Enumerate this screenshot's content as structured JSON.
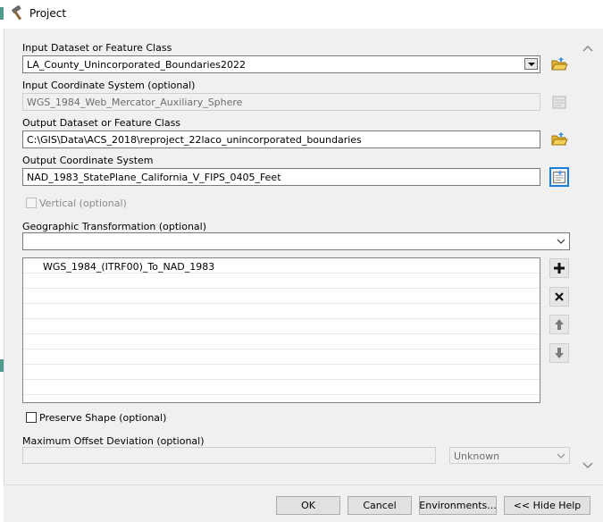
{
  "window": {
    "title": "Project"
  },
  "input_dataset": {
    "label": "Input Dataset or Feature Class",
    "value": "LA_County_Unincorporated_Boundaries2022"
  },
  "input_cs": {
    "label": "Input Coordinate System (optional)",
    "value": "WGS_1984_Web_Mercator_Auxiliary_Sphere"
  },
  "output_dataset": {
    "label": "Output Dataset or Feature Class",
    "value": "C:\\GIS\\Data\\ACS_2018\\reproject_22laco_unincorporated_boundaries"
  },
  "output_cs": {
    "label": "Output Coordinate System",
    "value": "NAD_1983_StatePlane_California_V_FIPS_0405_Feet"
  },
  "vertical": {
    "label": "Vertical (optional)",
    "checked": false
  },
  "geo_transform": {
    "label": "Geographic Transformation (optional)",
    "value": "",
    "items": [
      "WGS_1984_(ITRF00)_To_NAD_1983"
    ]
  },
  "preserve_shape": {
    "label": "Preserve Shape (optional)",
    "checked": false
  },
  "max_offset": {
    "label": "Maximum Offset Deviation (optional)",
    "value": "",
    "unit": "Unknown"
  },
  "footer": {
    "ok": "OK",
    "cancel": "Cancel",
    "environments": "Environments...",
    "hide_help": "<< Hide Help"
  },
  "colors": {
    "accent": "#1a7fd8",
    "panel": "#f0f0f0",
    "folder": "#e8b62e"
  }
}
